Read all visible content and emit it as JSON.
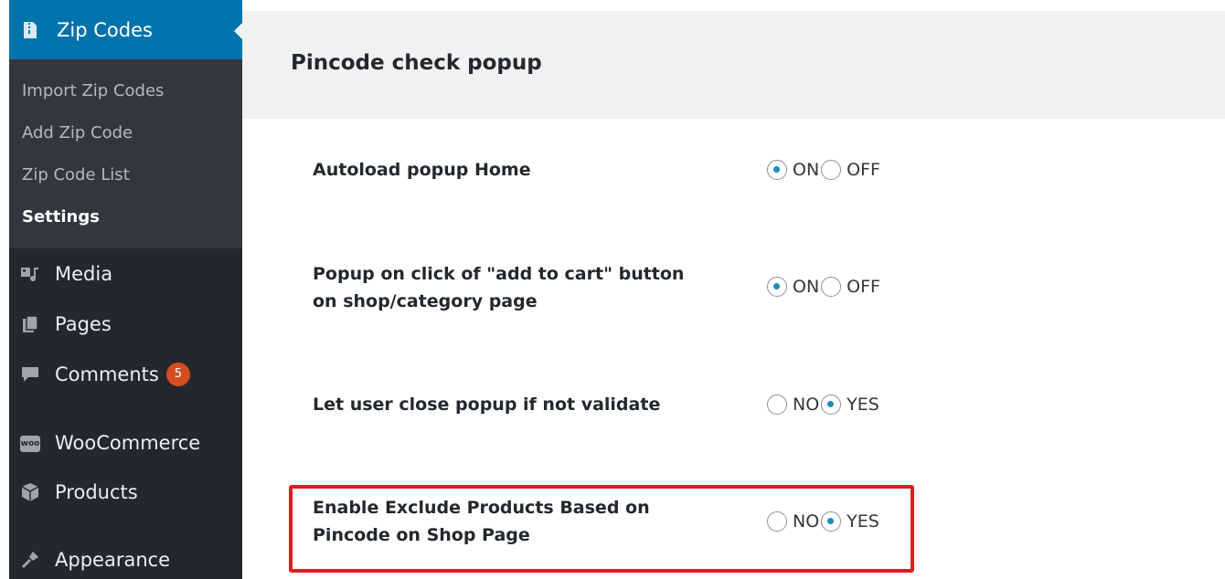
{
  "sidebar": {
    "active_menu": {
      "label": "Zip Codes",
      "icon": "zip-file-icon"
    },
    "submenu": [
      {
        "label": "Import Zip Codes",
        "current": false
      },
      {
        "label": "Add Zip Code",
        "current": false
      },
      {
        "label": "Zip Code List",
        "current": false
      },
      {
        "label": "Settings",
        "current": true
      }
    ],
    "menu": [
      {
        "label": "Media",
        "icon": "media-icon"
      },
      {
        "label": "Pages",
        "icon": "pages-icon"
      },
      {
        "label": "Comments",
        "icon": "comments-icon",
        "badge": "5"
      },
      {
        "label": "WooCommerce",
        "icon": "woocommerce-icon",
        "icon_text": "woo"
      },
      {
        "label": "Products",
        "icon": "products-icon"
      },
      {
        "label": "Appearance",
        "icon": "appearance-icon"
      }
    ]
  },
  "main": {
    "title": "Pincode check popup",
    "settings": [
      {
        "label_lines": [
          "Autoload popup Home"
        ],
        "options": [
          {
            "label": "ON",
            "checked": true
          },
          {
            "label": "OFF",
            "checked": false
          }
        ]
      },
      {
        "label_lines": [
          "Popup on click of \"add to cart\" button",
          "on shop/category page"
        ],
        "options": [
          {
            "label": "ON",
            "checked": true
          },
          {
            "label": "OFF",
            "checked": false
          }
        ]
      },
      {
        "label_lines": [
          "Let user close popup if not validate"
        ],
        "options": [
          {
            "label": "NO",
            "checked": false
          },
          {
            "label": "YES",
            "checked": true
          }
        ]
      },
      {
        "label_lines": [
          "Enable Exclude Products Based on",
          "Pincode on Shop Page"
        ],
        "options": [
          {
            "label": "NO",
            "checked": false
          },
          {
            "label": "YES",
            "checked": true
          }
        ],
        "highlighted": true
      }
    ]
  },
  "colors": {
    "sidebar_bg": "#23282d",
    "submenu_bg": "#32373c",
    "active_bg": "#0073aa",
    "highlight": "#e01c1c",
    "badge": "#d54e21"
  }
}
